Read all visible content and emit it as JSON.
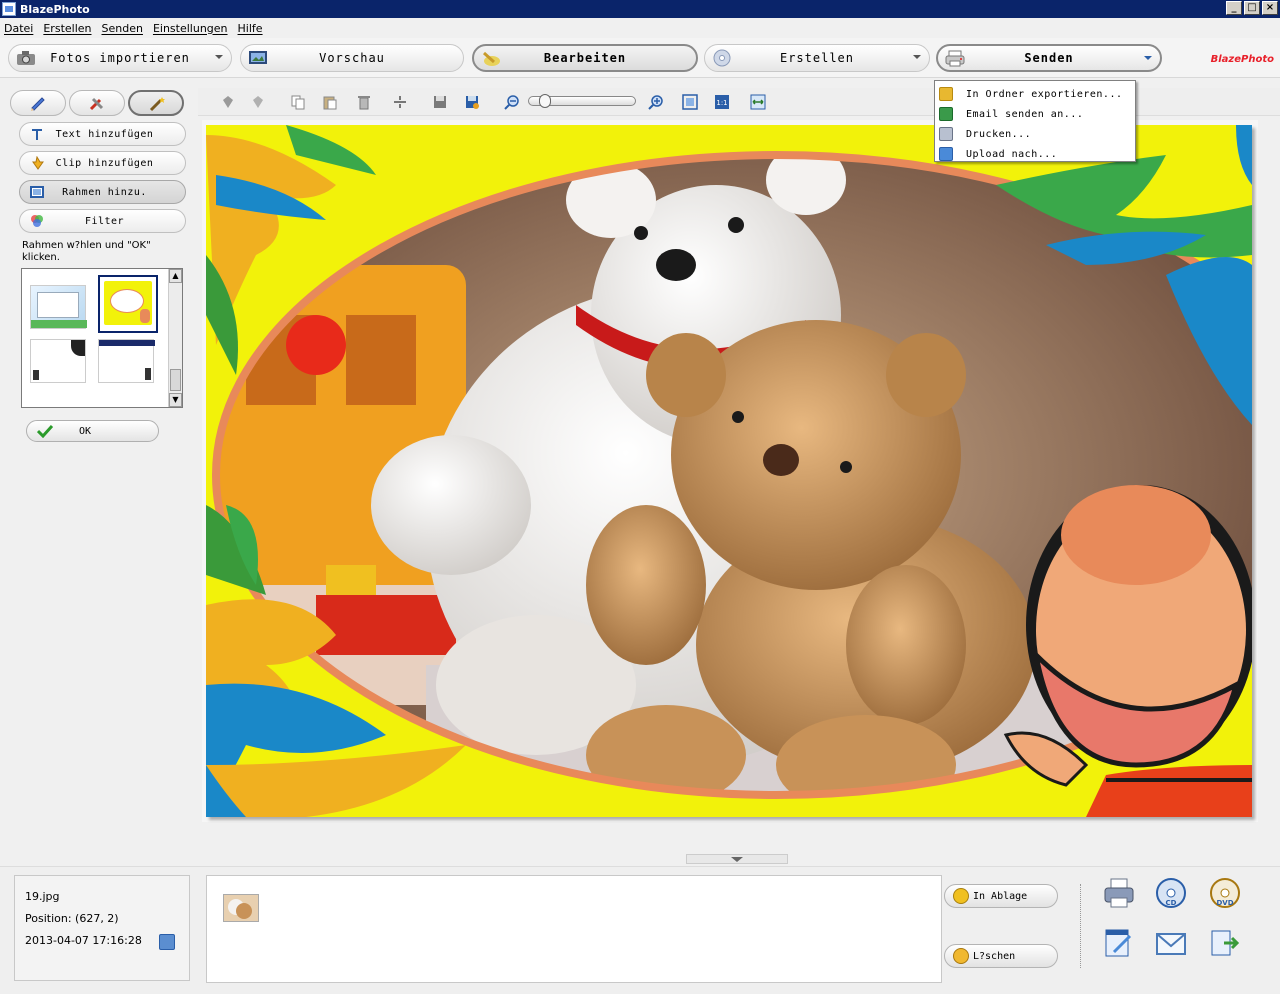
{
  "window": {
    "title": "BlazePhoto"
  },
  "menu": [
    "Datei",
    "Erstellen",
    "Senden",
    "Einstellungen",
    "Hilfe"
  ],
  "main_tabs": {
    "import": "Fotos importieren",
    "preview": "Vorschau",
    "edit": "Bearbeiten",
    "create": "Erstellen",
    "send": "Senden"
  },
  "brand": "BlazePhoto",
  "send_menu": [
    "In Ordner exportieren...",
    "Email senden an...",
    "Drucken...",
    "Upload nach..."
  ],
  "left_panel": {
    "buttons": [
      "Text hinzufügen",
      "Clip hinzufügen",
      "Rahmen hinzu.",
      "Filter"
    ],
    "hint": "Rahmen w?hlen und \"OK\" klicken.",
    "ok_label": "OK"
  },
  "info": {
    "filename": "19.jpg",
    "position": "Position: (627, 2)",
    "datetime": "2013-04-07 17:16:28"
  },
  "tray_buttons": {
    "clipboard": "In Ablage",
    "delete": "L?schen"
  },
  "colors": {
    "frame_yellow": "#f2f20a",
    "title_bar": "#0a246a",
    "accent_red": "#e8202a"
  }
}
